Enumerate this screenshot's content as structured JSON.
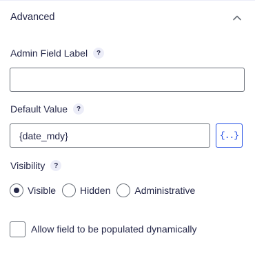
{
  "section": {
    "title": "Advanced",
    "collapse_icon": "chevron-up-icon"
  },
  "admin_label": {
    "label": "Admin Field Label",
    "help": "?",
    "value": ""
  },
  "default_value": {
    "label": "Default Value",
    "help": "?",
    "value": "{date_mdy}",
    "merge_tag_button": "{..}"
  },
  "visibility": {
    "label": "Visibility",
    "help": "?",
    "options": [
      "Visible",
      "Hidden",
      "Administrative"
    ],
    "selected": "Visible"
  },
  "dynamic_population": {
    "label": "Allow field to be populated dynamically",
    "checked": false
  }
}
